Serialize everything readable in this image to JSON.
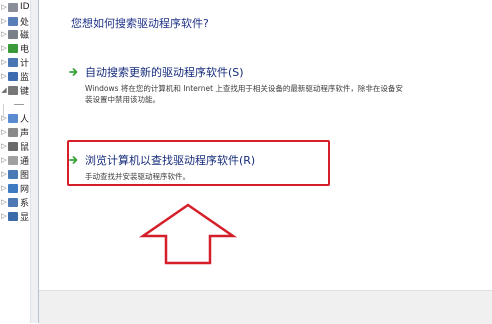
{
  "tree": {
    "items": [
      {
        "label": "IDE",
        "icon_color": "#8a8f99",
        "expander": "▷"
      },
      {
        "label": "处",
        "icon_color": "#5a7fb8",
        "expander": "▷"
      },
      {
        "label": "磁",
        "icon_color": "#7a8088",
        "expander": "▷"
      },
      {
        "label": "电",
        "icon_color": "#3a9a3a",
        "expander": "▷"
      },
      {
        "label": "计",
        "icon_color": "#4a76b4",
        "expander": "▷"
      },
      {
        "label": "监",
        "icon_color": "#3d6bb0",
        "expander": "▷"
      },
      {
        "label": "键",
        "icon_color": "#777777",
        "expander": "◢"
      },
      {
        "label": "",
        "icon_color": "#9a9a9a",
        "expander": ""
      },
      {
        "label": "人",
        "icon_color": "#5a8ad0",
        "expander": "▷"
      },
      {
        "label": "声",
        "icon_color": "#8a8a8a",
        "expander": "▷"
      },
      {
        "label": "鼠",
        "icon_color": "#6a6a6a",
        "expander": "▷"
      },
      {
        "label": "通",
        "icon_color": "#a0a0a0",
        "expander": "▷"
      },
      {
        "label": "图",
        "icon_color": "#4a7ab5",
        "expander": "▷"
      },
      {
        "label": "网",
        "icon_color": "#3d7ac0",
        "expander": "▷"
      },
      {
        "label": "系",
        "icon_color": "#4f79b3",
        "expander": "▷"
      },
      {
        "label": "显",
        "icon_color": "#3a6aa8",
        "expander": "▷"
      }
    ]
  },
  "wizard": {
    "question": "您想如何搜索驱动程序软件?",
    "options": [
      {
        "title": "自动搜索更新的驱动程序软件(S)",
        "description": "Windows 将在您的计算机和 Internet 上查找用于相关设备的最新驱动程序软件，除非在设备安装设置中禁用该功能。"
      },
      {
        "title": "浏览计算机以查找驱动程序软件(R)",
        "description": "手动查找并安装驱动程序软件。"
      }
    ]
  },
  "colors": {
    "link_text": "#152b7b",
    "arrow_green": "#3aa33a",
    "highlight_red": "#d41f2a"
  },
  "icons": {
    "option_arrow": "green-right-arrow-icon",
    "annotation": "red-up-arrow-icon"
  }
}
